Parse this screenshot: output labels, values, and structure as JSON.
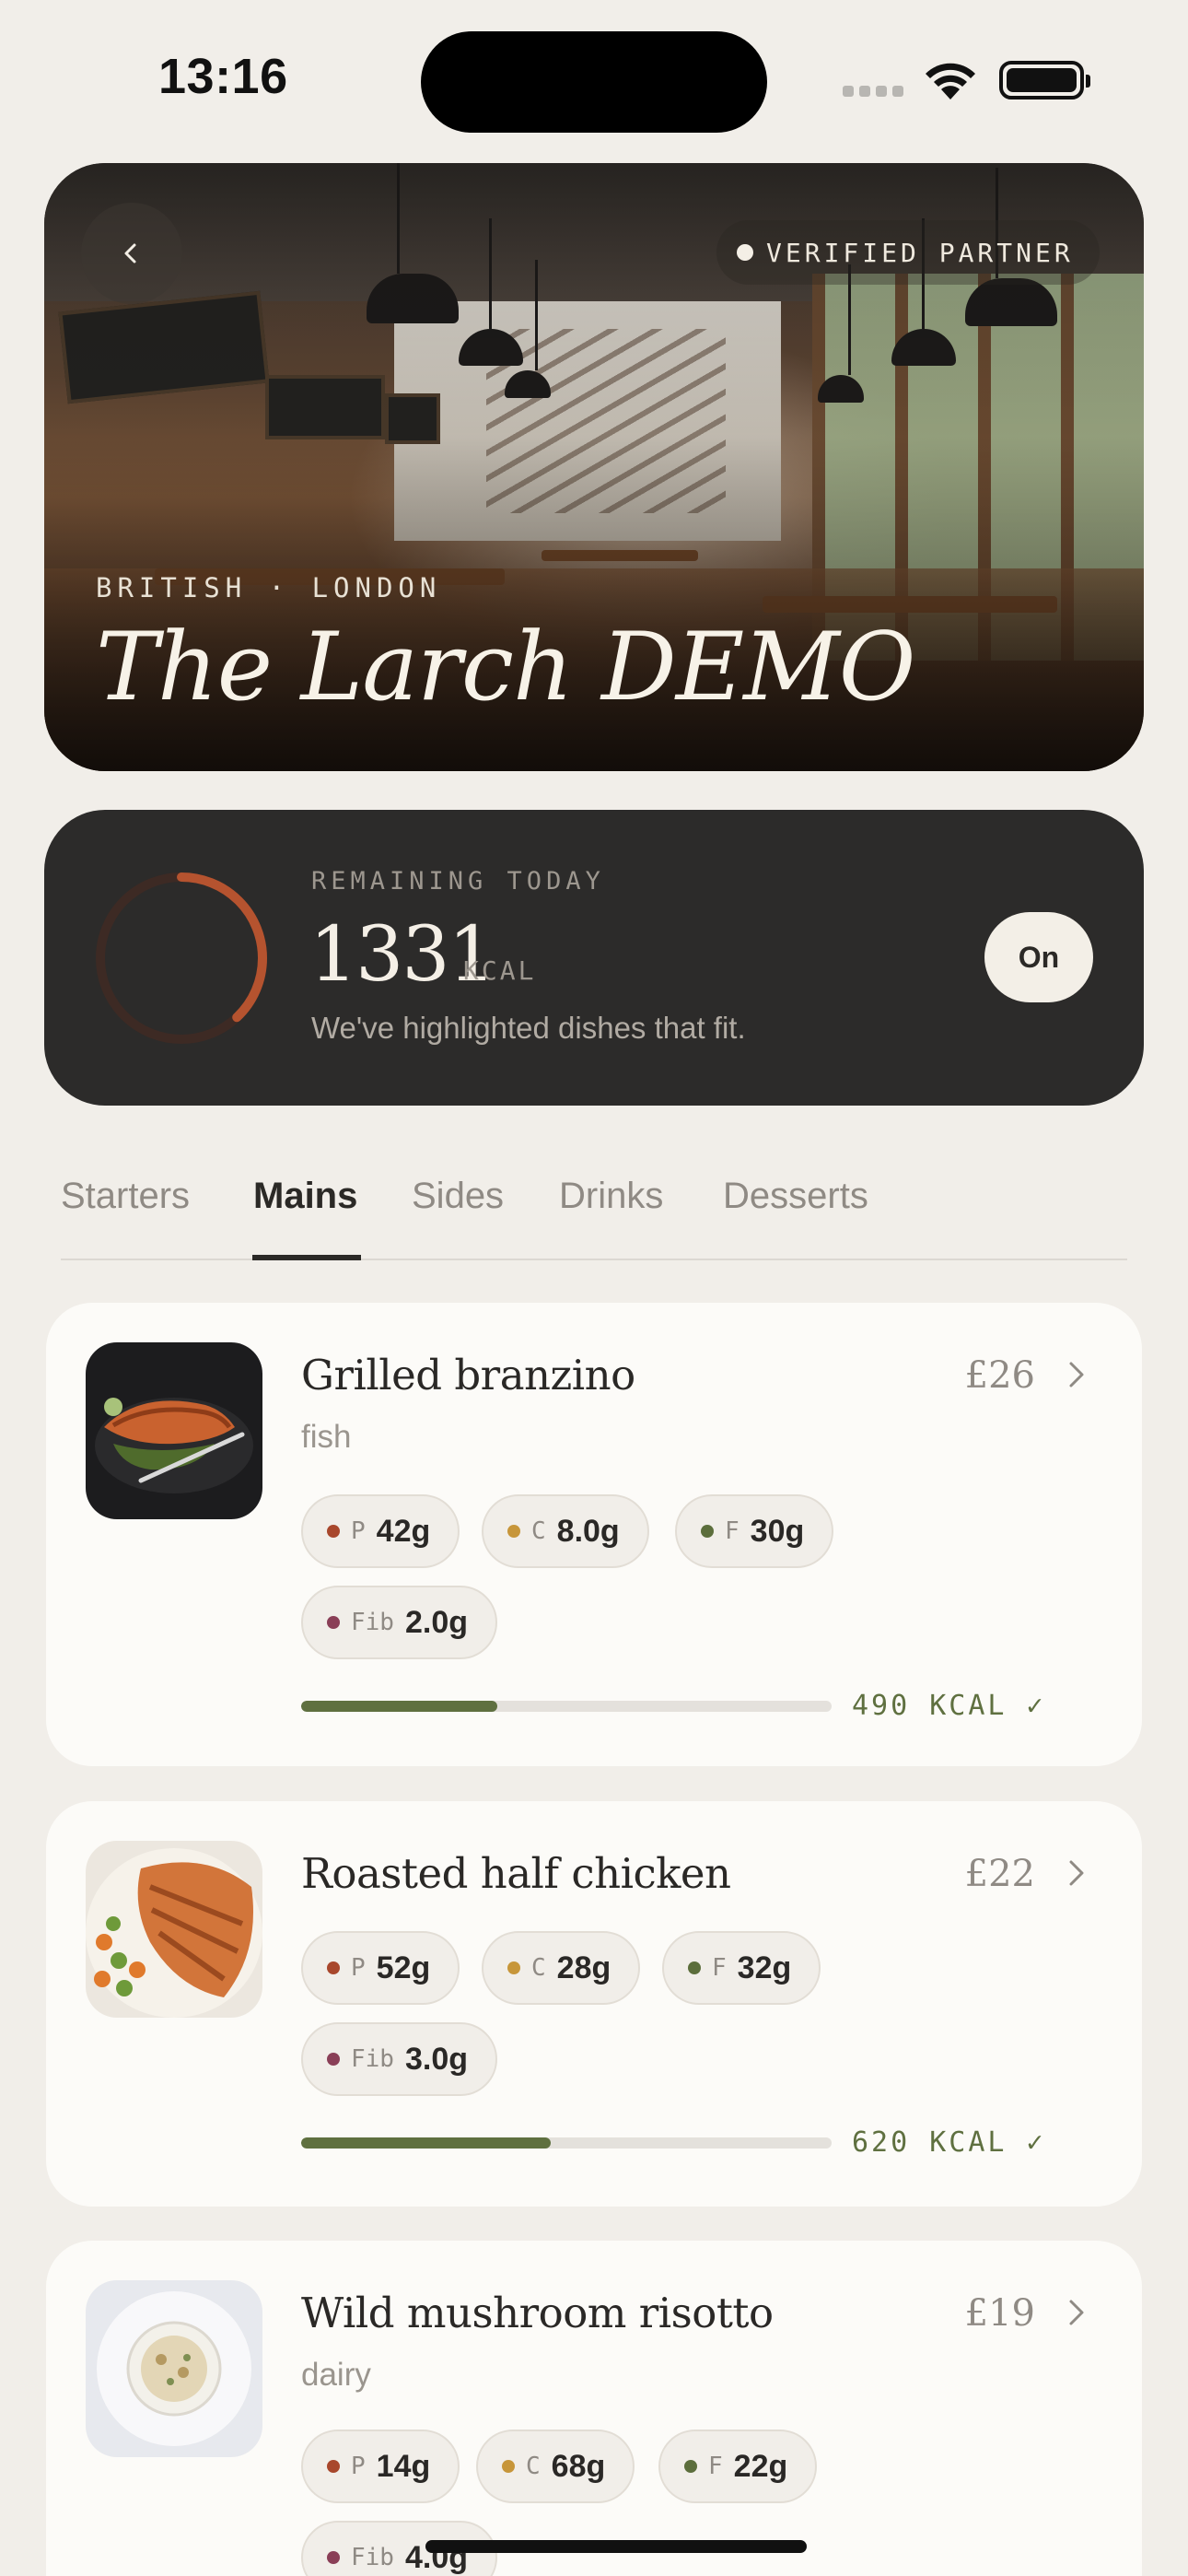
{
  "status_bar": {
    "time": "13:16"
  },
  "hero": {
    "verified_label": "VERIFIED PARTNER",
    "cuisine": "BRITISH · LONDON",
    "name": "The Larch DEMO"
  },
  "remaining": {
    "label": "REMAINING TODAY",
    "value": "1331",
    "unit": "KCAL",
    "note": "We've highlighted dishes that fit.",
    "toggle_label": "On",
    "ring_progress": 0.38,
    "ring_color": "#b5532f"
  },
  "tabs": [
    {
      "label": "Starters",
      "active": false
    },
    {
      "label": "Mains",
      "active": true
    },
    {
      "label": "Sides",
      "active": false
    },
    {
      "label": "Drinks",
      "active": false
    },
    {
      "label": "Desserts",
      "active": false
    }
  ],
  "colors": {
    "protein": "#a8472c",
    "carbs": "#c7963a",
    "fat": "#5c6e3c",
    "fiber": "#8a3f57",
    "kcal": "#5f7040"
  },
  "dishes": [
    {
      "name": "Grilled branzino",
      "price": "£26",
      "tag": "fish",
      "thumb_icon": "grilled-fish-plate",
      "protein": {
        "label": "P",
        "value": "42g"
      },
      "carbs": {
        "label": "C",
        "value": "8.0g"
      },
      "fat": {
        "label": "F",
        "value": "30g"
      },
      "fiber": {
        "label": "Fib",
        "value": "2.0g"
      },
      "kcal_text": "490 KCAL ✓",
      "kcal_fraction": 0.37
    },
    {
      "name": "Roasted half chicken",
      "price": "£22",
      "tag": "",
      "thumb_icon": "roasted-chicken-plate",
      "protein": {
        "label": "P",
        "value": "52g"
      },
      "carbs": {
        "label": "C",
        "value": "28g"
      },
      "fat": {
        "label": "F",
        "value": "32g"
      },
      "fiber": {
        "label": "Fib",
        "value": "3.0g"
      },
      "kcal_text": "620 KCAL ✓",
      "kcal_fraction": 0.47
    },
    {
      "name": "Wild mushroom risotto",
      "price": "£19",
      "tag": "dairy",
      "thumb_icon": "risotto-bowl",
      "protein": {
        "label": "P",
        "value": "14g"
      },
      "carbs": {
        "label": "C",
        "value": "68g"
      },
      "fat": {
        "label": "F",
        "value": "22g"
      },
      "fiber": {
        "label": "Fib",
        "value": "4.0g"
      }
    }
  ]
}
